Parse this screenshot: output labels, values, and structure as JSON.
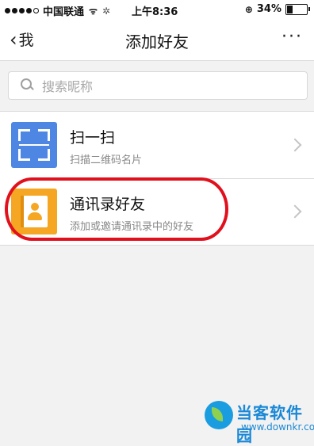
{
  "status_bar": {
    "signal_dots_filled": 4,
    "signal_dots_total": 5,
    "carrier": "中国联通",
    "wifi_icon": "wifi-icon",
    "time": "上午8:36",
    "battery_percent": "34%",
    "battery_level": 0.34
  },
  "nav": {
    "back_label": "我",
    "title": "添加好友",
    "more_label": "···"
  },
  "search": {
    "placeholder": "搜索昵称"
  },
  "items": [
    {
      "title": "扫一扫",
      "subtitle": "扫描二维码名片",
      "icon": "scan-icon",
      "icon_color": "#4e86e4"
    },
    {
      "title": "通讯录好友",
      "subtitle": "添加或邀请通讯录中的好友",
      "icon": "contacts-book-icon",
      "icon_color": "#f5a623",
      "highlighted": true
    }
  ],
  "highlight_color": "#e0101c",
  "watermark": {
    "name": "当客软件园",
    "url": "www.downkr.com"
  }
}
